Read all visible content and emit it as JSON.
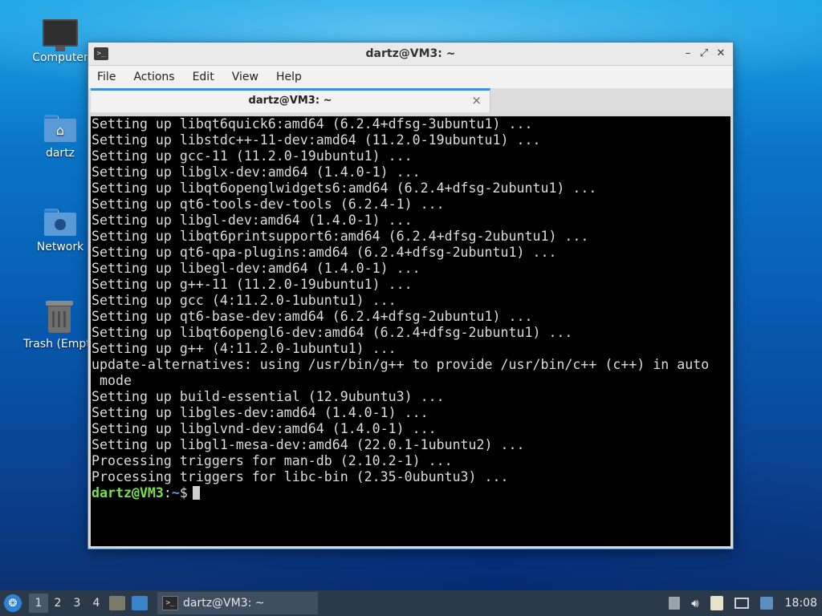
{
  "desktop": {
    "icons": [
      {
        "label": "Computer",
        "icon": "computer-icon"
      },
      {
        "label": "dartz",
        "icon": "home-folder-icon"
      },
      {
        "label": "Network",
        "icon": "network-folder-icon"
      },
      {
        "label": "Trash (Empt",
        "icon": "trash-icon"
      }
    ]
  },
  "window": {
    "title": "dartz@VM3: ~",
    "menu": [
      "File",
      "Actions",
      "Edit",
      "View",
      "Help"
    ],
    "tab_label": "dartz@VM3: ~",
    "tab_close": "×"
  },
  "terminal": {
    "lines": [
      "Setting up libqt6quick6:amd64 (6.2.4+dfsg-3ubuntu1) ...",
      "Setting up libstdc++-11-dev:amd64 (11.2.0-19ubuntu1) ...",
      "Setting up gcc-11 (11.2.0-19ubuntu1) ...",
      "Setting up libglx-dev:amd64 (1.4.0-1) ...",
      "Setting up libqt6openglwidgets6:amd64 (6.2.4+dfsg-2ubuntu1) ...",
      "Setting up qt6-tools-dev-tools (6.2.4-1) ...",
      "Setting up libgl-dev:amd64 (1.4.0-1) ...",
      "Setting up libqt6printsupport6:amd64 (6.2.4+dfsg-2ubuntu1) ...",
      "Setting up qt6-qpa-plugins:amd64 (6.2.4+dfsg-2ubuntu1) ...",
      "Setting up libegl-dev:amd64 (1.4.0-1) ...",
      "Setting up g++-11 (11.2.0-19ubuntu1) ...",
      "Setting up gcc (4:11.2.0-1ubuntu1) ...",
      "Setting up qt6-base-dev:amd64 (6.2.4+dfsg-2ubuntu1) ...",
      "Setting up libqt6opengl6-dev:amd64 (6.2.4+dfsg-2ubuntu1) ...",
      "Setting up g++ (4:11.2.0-1ubuntu1) ...",
      "update-alternatives: using /usr/bin/g++ to provide /usr/bin/c++ (c++) in auto",
      " mode",
      "Setting up build-essential (12.9ubuntu3) ...",
      "Setting up libgles-dev:amd64 (1.4.0-1) ...",
      "Setting up libglvnd-dev:amd64 (1.4.0-1) ...",
      "Setting up libgl1-mesa-dev:amd64 (22.0.1-1ubuntu2) ...",
      "Processing triggers for man-db (2.10.2-1) ...",
      "Processing triggers for libc-bin (2.35-0ubuntu3) ..."
    ],
    "prompt_user": "dartz@VM3",
    "prompt_sep": ":",
    "prompt_path": "~",
    "prompt_symbol": "$"
  },
  "taskbar": {
    "workspaces": [
      "1",
      "2",
      "3",
      "4"
    ],
    "active_workspace": "1",
    "task_label": "dartz@VM3: ~",
    "clock": "18:08"
  },
  "colors": {
    "prompt_user": "#7be04a",
    "prompt_path": "#4aa0f0",
    "tab_accent": "#3a8ee6"
  }
}
